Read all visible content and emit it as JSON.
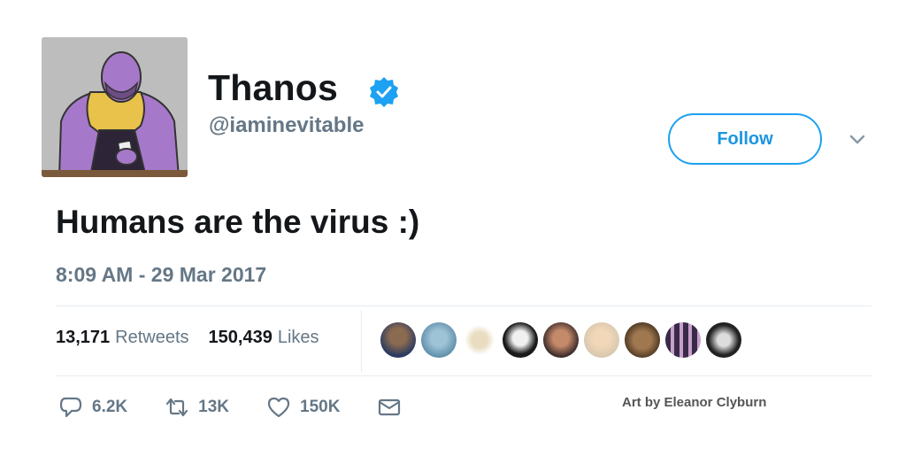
{
  "user": {
    "display_name": "Thanos",
    "handle": "@iaminevitable",
    "verified": true
  },
  "follow_label": "Follow",
  "tweet": {
    "text": "Humans are the virus :)",
    "timestamp": "8:09 AM - 29 Mar 2017"
  },
  "stats": {
    "retweets_count": "13,171",
    "retweets_label": "Retweets",
    "likes_count": "150,439",
    "likes_label": "Likes"
  },
  "liked_by_avatars": [
    "avatar-1",
    "avatar-2",
    "avatar-3",
    "avatar-4",
    "avatar-5",
    "avatar-6",
    "avatar-7",
    "avatar-8",
    "avatar-9"
  ],
  "actions": {
    "reply_count": "6.2K",
    "retweet_count": "13K",
    "like_count": "150K"
  },
  "credit": "Art by Eleanor Clyburn",
  "colors": {
    "accent": "#1da1f2",
    "text_primary": "#14171a",
    "text_secondary": "#657786"
  },
  "icons": [
    "verified-badge-icon",
    "chevron-down-icon",
    "reply-icon",
    "retweet-icon",
    "like-icon",
    "message-icon"
  ]
}
